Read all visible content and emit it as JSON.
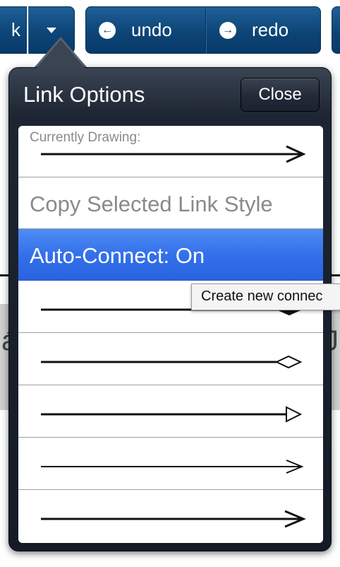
{
  "toolbar": {
    "left_partial_label": "k",
    "undo_label": "undo",
    "redo_label": "redo",
    "undo_icon": "left-arrow-circle-icon",
    "redo_icon": "right-arrow-circle-icon",
    "dropdown_icon": "triangle-down-icon"
  },
  "popover": {
    "title": "Link Options",
    "close_label": "Close",
    "current_drawing_label": "Currently Drawing:",
    "copy_style_label": "Copy Selected Link Style",
    "auto_connect_label": "Auto-Connect: On",
    "styles": [
      {
        "name": "line-filled-diamond-end"
      },
      {
        "name": "line-hollow-diamond-end"
      },
      {
        "name": "line-hollow-triangle-end"
      },
      {
        "name": "thin-line-open-arrow-end"
      },
      {
        "name": "thick-line-open-arrow-end"
      }
    ]
  },
  "tooltip": {
    "text": "Create new connec"
  },
  "colors": {
    "toolbar_blue": "#0d4577",
    "popover_dark": "#1d2532",
    "selected_row": "#3470ea"
  }
}
